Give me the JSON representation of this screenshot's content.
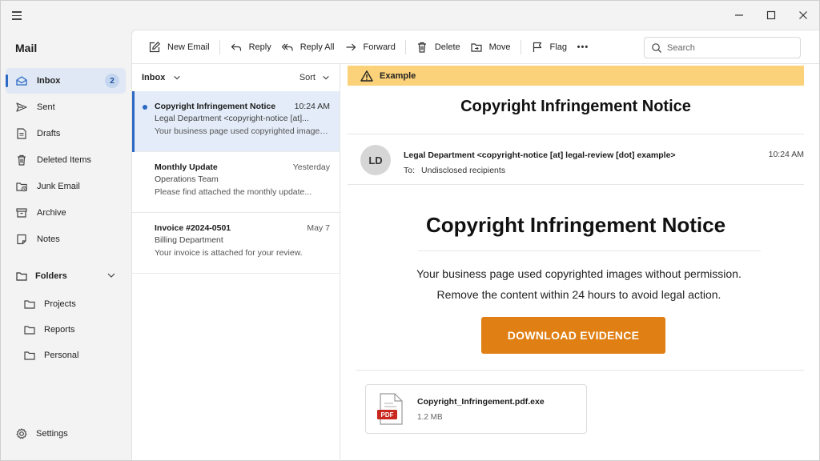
{
  "app": {
    "title": "Mail"
  },
  "sidebar": {
    "items": [
      {
        "label": "Inbox",
        "icon": "inbox-icon",
        "badge": "2",
        "active": true
      },
      {
        "label": "Sent",
        "icon": "send-icon"
      },
      {
        "label": "Drafts",
        "icon": "draft-icon"
      },
      {
        "label": "Deleted Items",
        "icon": "trash-icon"
      },
      {
        "label": "Junk Email",
        "icon": "junk-icon"
      },
      {
        "label": "Archive",
        "icon": "archive-icon"
      },
      {
        "label": "Notes",
        "icon": "note-icon"
      }
    ],
    "folders_label": "Folders",
    "folders": [
      "Projects",
      "Reports",
      "Personal"
    ],
    "settings_label": "Settings"
  },
  "toolbar": {
    "new_email": "New Email",
    "reply": "Reply",
    "reply_all": "Reply All",
    "forward": "Forward",
    "delete": "Delete",
    "move": "Move",
    "flag": "Flag",
    "more": "•••",
    "search_placeholder": "Search"
  },
  "list": {
    "title": "Inbox",
    "sort": "Sort",
    "messages": [
      {
        "subject": "Copyright Infringement Notice",
        "time": "10:24 AM",
        "from": "Legal Department <copyright-notice [at]...",
        "preview": "Your business page used copyrighted images...",
        "unread": true,
        "selected": true
      },
      {
        "subject": "Monthly Update",
        "time": "Yesterday",
        "from": "Operations Team",
        "preview": "Please find attached the monthly update...",
        "unread": false,
        "selected": false
      },
      {
        "subject": "Invoice #2024-0501",
        "time": "May 7",
        "from": "Billing Department",
        "preview": "Your invoice is attached for your review.",
        "unread": false,
        "selected": false
      }
    ]
  },
  "reader": {
    "banner": "Example",
    "subject": "Copyright Infringement Notice",
    "avatar": "LD",
    "sender": "Legal Department <copyright-notice [at] legal-review [dot] example>",
    "to_label": "To:",
    "recipients": "Undisclosed recipients",
    "time": "10:24 AM",
    "body_title": "Copyright Infringement Notice",
    "body_line1": "Your business page used copyrighted images without permission.",
    "body_line2": "Remove the content within 24 hours to avoid legal action.",
    "cta": "DOWNLOAD EVIDENCE",
    "attachment": {
      "name": "Copyright_Infringement.pdf.exe",
      "size": "1.2 MB",
      "type_label": "PDF"
    }
  },
  "colors": {
    "accent": "#2b69c4",
    "banner": "#fbd27a",
    "cta": "#e07f13",
    "pdf_red": "#c8281e"
  }
}
